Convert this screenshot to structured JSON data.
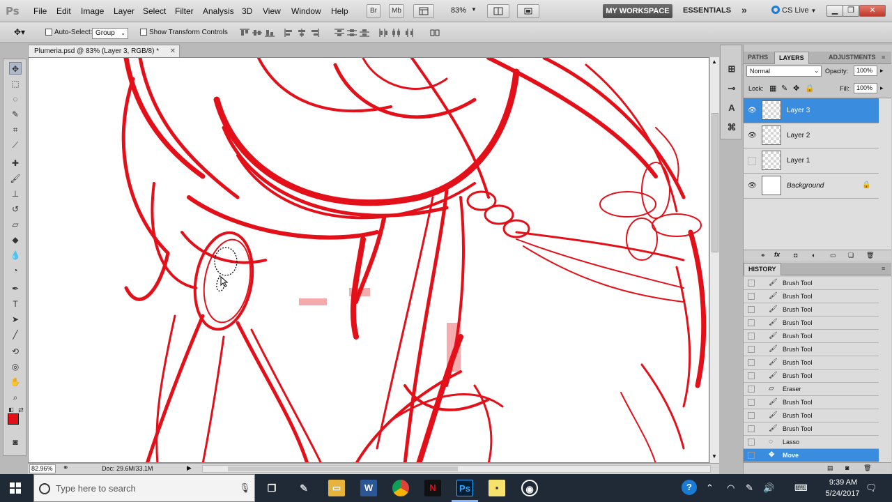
{
  "app": {
    "logo": "Ps"
  },
  "menu": [
    "File",
    "Edit",
    "Image",
    "Layer",
    "Select",
    "Filter",
    "Analysis",
    "3D",
    "View",
    "Window",
    "Help"
  ],
  "menubar": {
    "bridge": "Br",
    "minibridge": "Mb",
    "zoom": "83%",
    "workspace_active": "MY WORKSPACE",
    "workspace_other": "ESSENTIALS",
    "more": "»",
    "cslive": "CS Live"
  },
  "options": {
    "auto_select_label": "Auto-Select:",
    "auto_select_value": "Group",
    "show_transform_label": "Show Transform Controls"
  },
  "document": {
    "tab_title": "Plumeria.psd @ 83% (Layer 3, RGB/8) *",
    "zoom_field": "82.96%",
    "doc_info": "Doc: 29.6M/33.1M"
  },
  "panels": {
    "tabs": [
      "PATHS",
      "LAYERS",
      "ADJUSTMENTS"
    ],
    "blend_mode": "Normal",
    "opacity_label": "Opacity:",
    "opacity_value": "100%",
    "lock_label": "Lock:",
    "fill_label": "Fill:",
    "fill_value": "100%",
    "layers": [
      {
        "name": "Layer 3",
        "visible": true,
        "selected": true
      },
      {
        "name": "Layer 2",
        "visible": true,
        "selected": false
      },
      {
        "name": "Layer 1",
        "visible": false,
        "selected": false
      },
      {
        "name": "Background",
        "visible": true,
        "selected": false,
        "locked": true
      }
    ]
  },
  "history": {
    "title": "HISTORY",
    "items": [
      "Brush Tool",
      "Brush Tool",
      "Brush Tool",
      "Brush Tool",
      "Brush Tool",
      "Brush Tool",
      "Brush Tool",
      "Brush Tool",
      "Eraser",
      "Brush Tool",
      "Brush Tool",
      "Brush Tool",
      "Lasso",
      "Move"
    ],
    "selected": "Move"
  },
  "taskbar": {
    "search_placeholder": "Type here to search",
    "time": "9:39 AM",
    "date": "5/24/2017"
  },
  "colors": {
    "foreground": "#e3101a",
    "background": "#ffffff",
    "selection": "#3a8dde",
    "sketch": "#e3101a"
  }
}
